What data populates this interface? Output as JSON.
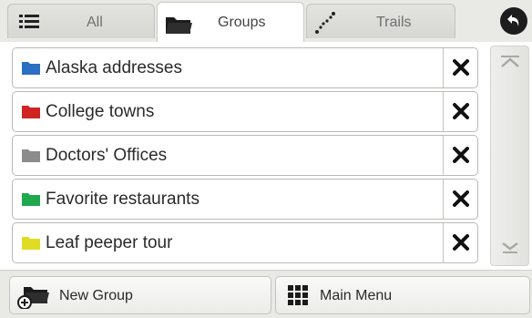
{
  "tabs": [
    {
      "label": "All",
      "icon": "list-icon",
      "active": false
    },
    {
      "label": "Groups",
      "icon": "folder-icon",
      "active": true
    },
    {
      "label": "Trails",
      "icon": "trail-icon",
      "active": false
    }
  ],
  "back_button": {
    "icon": "back-arrow-icon"
  },
  "groups": [
    {
      "name": "Alaska addresses",
      "color": "#2b6fc2"
    },
    {
      "name": "College towns",
      "color": "#d02424"
    },
    {
      "name": "Doctors' Offices",
      "color": "#8c8c8c"
    },
    {
      "name": "Favorite restaurants",
      "color": "#1fa84d"
    },
    {
      "name": "Leaf peeper tour",
      "color": "#e0dc23"
    }
  ],
  "delete_icon": "close-icon",
  "scrollbar": {
    "up_icon": "scroll-top-icon",
    "down_icon": "scroll-down-icon"
  },
  "bottom_bar": {
    "new_group_label": "New Group",
    "new_group_icon": "new-folder-icon",
    "main_menu_label": "Main Menu",
    "main_menu_icon": "grid-icon"
  }
}
